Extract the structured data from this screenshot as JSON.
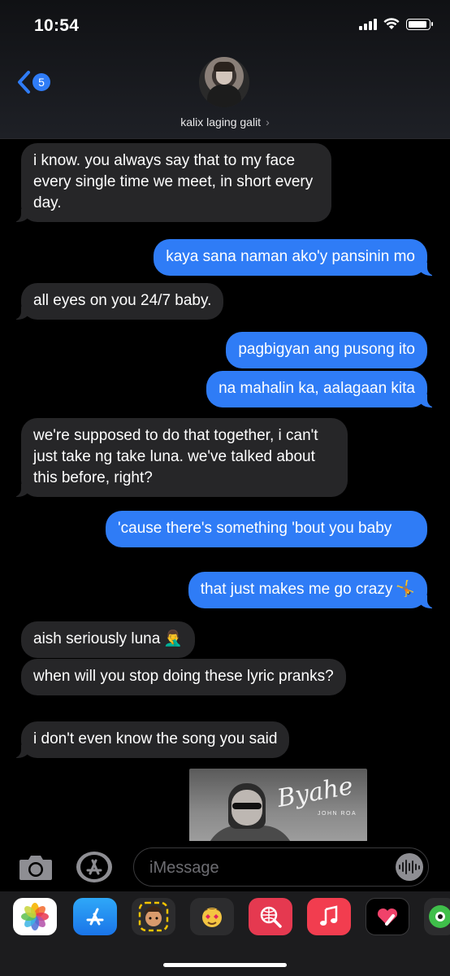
{
  "status_bar": {
    "time": "10:54"
  },
  "header": {
    "back_badge": "5",
    "contact_name": "kalix laging galit",
    "contact_chevron": "›"
  },
  "messages": [
    {
      "side": "in",
      "text": "i know. you always say that to my face every single time we meet, in short every day."
    },
    {
      "side": "out",
      "text": "kaya sana naman ako'y pansinin mo"
    },
    {
      "side": "in",
      "text": "all eyes on you 24/7 baby."
    },
    {
      "side": "out",
      "text": "pagbigyan ang pusong ito"
    },
    {
      "side": "out",
      "text": "na mahalin ka, aalagaan kita"
    },
    {
      "side": "in",
      "text": "we're supposed to do that together, i can't just take ng take luna. we've talked about this before, right?"
    },
    {
      "side": "out",
      "text": "'cause there's something 'bout you baby"
    },
    {
      "side": "out",
      "text": "that just makes me go crazy",
      "emoji": "🤸"
    },
    {
      "side": "in",
      "text": "aish seriously luna",
      "emoji": "🤦‍♂️"
    },
    {
      "side": "in",
      "text": "when will you stop doing these lyric pranks?"
    },
    {
      "side": "in",
      "text": "i don't even know the song you said"
    }
  ],
  "attachment": {
    "title": "Byahe",
    "subtitle": "JOHN ROA"
  },
  "input": {
    "placeholder": "iMessage"
  },
  "app_drawer": [
    "photos-icon",
    "app-store-icon",
    "memoji-icon",
    "animoji-icon",
    "web-search-icon",
    "music-icon",
    "digital-touch-icon",
    "more-apps-icon"
  ]
}
